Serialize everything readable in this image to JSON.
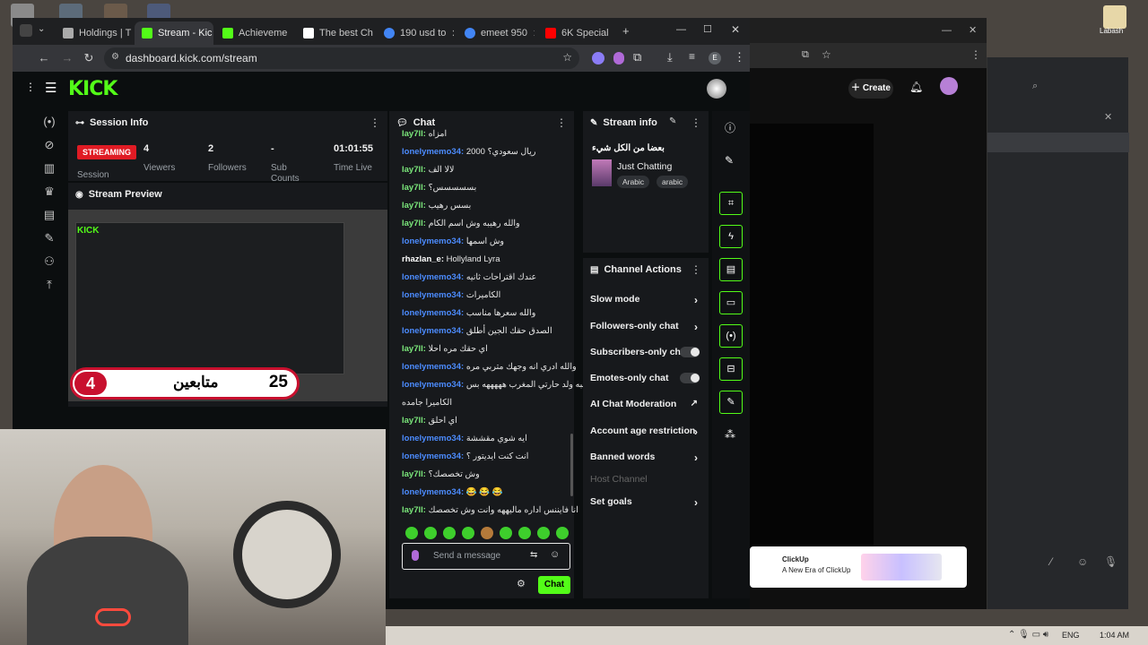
{
  "desktop": {
    "icon_label": "Labash"
  },
  "browser": {
    "tabs": [
      {
        "label": "Holdings | T",
        "color": "#aaaaaa",
        "active": false
      },
      {
        "label": "Stream - Kic",
        "color": "#53fc18",
        "active": true
      },
      {
        "label": "Achieveme",
        "color": "#53fc18",
        "active": false
      },
      {
        "label": "The best Ch",
        "color": "#ffffff",
        "active": false
      },
      {
        "label": "190 usd to",
        "color": "#4285f4",
        "active": false
      },
      {
        "label": "emeet 950",
        "color": "#4285f4",
        "active": false
      },
      {
        "label": "6K Special",
        "color": "#ff0000",
        "active": false
      }
    ],
    "url": "dashboard.kick.com/stream"
  },
  "kick": {
    "logo": "KICK",
    "create_label": "Create",
    "accent": "#53fc18",
    "session": {
      "title": "Session Info",
      "status": "STREAMING",
      "status_label": "Session",
      "viewers": "4",
      "viewers_label": "Viewers",
      "followers": "2",
      "followers_label": "Followers",
      "subs": "-",
      "subs_label": "Sub Counts",
      "time": "01:01:55",
      "time_label": "Time Live"
    },
    "preview": {
      "title": "Stream Preview",
      "left_count": "4",
      "right_count": "25",
      "overlay_text": "متابعين"
    },
    "chat": {
      "title": "Chat",
      "placeholder": "Send a message",
      "send_label": "Chat",
      "messages": [
        {
          "user": "lay7ll:",
          "text": "امزاه",
          "kind": "u2"
        },
        {
          "user": "lonelymemo34:",
          "text": "ريال سعودي؟ 2000",
          "kind": "u1"
        },
        {
          "user": "lay7ll:",
          "text": "لالا الف",
          "kind": "u2"
        },
        {
          "user": "lay7ll:",
          "text": "بسسسسس؟",
          "kind": "u2"
        },
        {
          "user": "lay7ll:",
          "text": "بسس رهيب",
          "kind": "u2"
        },
        {
          "user": "lay7ll:",
          "text": "والله رهيبه وش اسم الكام",
          "kind": "u2"
        },
        {
          "user": "lonelymemo34:",
          "text": "وش اسمها",
          "kind": "u1"
        },
        {
          "user": "rhazlan_e:",
          "text": "Hollyland Lyra",
          "kind": "u3"
        },
        {
          "user": "lonelymemo34:",
          "text": "عندك اقتراحات ثانيه",
          "kind": "u1"
        },
        {
          "user": "lonelymemo34:",
          "text": "الكاميرات",
          "kind": "u1"
        },
        {
          "user": "lonelymemo34:",
          "text": "والله سعرها مناسب",
          "kind": "u1"
        },
        {
          "user": "lonelymemo34:",
          "text": "الصدق حقك الجين أطلق",
          "kind": "u1"
        },
        {
          "user": "lay7ll:",
          "text": "اي حقك مره احلا",
          "kind": "u2"
        },
        {
          "user": "lonelymemo34:",
          "text": "والله ادري انه وجهك متربي مره",
          "kind": "u1"
        },
        {
          "user": "lonelymemo34:",
          "text": "تشبه ولد حارتي المغرب هههههه بس",
          "kind": "u1"
        },
        {
          "user": "",
          "text": "الكاميرا جامده",
          "kind": "u1"
        },
        {
          "user": "lay7ll:",
          "text": "اي احلق",
          "kind": "u2"
        },
        {
          "user": "lonelymemo34:",
          "text": "ايه شوي مقششة",
          "kind": "u1"
        },
        {
          "user": "lonelymemo34:",
          "text": "انت كنت ايديتور ؟",
          "kind": "u1"
        },
        {
          "user": "lay7ll:",
          "text": "وش تخصصك؟",
          "kind": "u2"
        },
        {
          "user": "lonelymemo34:",
          "text": "😂 😂 😂",
          "kind": "u1"
        },
        {
          "user": "lay7ll:",
          "text": "انا فايننس اداره ماليههه وانت وش تخصصك",
          "kind": "u2"
        }
      ]
    },
    "stream_info": {
      "title": "Stream info",
      "stream_title": "بعضا من الكل شيء",
      "category": "Just Chatting",
      "tags": [
        "Arabic",
        "arabic"
      ]
    },
    "channel_actions": {
      "title": "Channel Actions",
      "items": [
        {
          "label": "Slow mode",
          "control": "chevron"
        },
        {
          "label": "Followers-only chat",
          "control": "chevron"
        },
        {
          "label": "Subscribers-only chat",
          "control": "toggle"
        },
        {
          "label": "Emotes-only chat",
          "control": "toggle"
        },
        {
          "label": "AI Chat Moderation",
          "control": "external"
        },
        {
          "label": "Account age restriction",
          "control": "chevron"
        },
        {
          "label": "Banned words",
          "control": "chevron"
        },
        {
          "label": "Host Channel",
          "control": "disabled"
        },
        {
          "label": "Set goals",
          "control": "chevron"
        }
      ]
    }
  },
  "ad": {
    "brand": "ClickUp",
    "tagline": "A New Era of ClickUp"
  },
  "taskbar": {
    "lang": "ENG",
    "time": "1:04 AM"
  }
}
